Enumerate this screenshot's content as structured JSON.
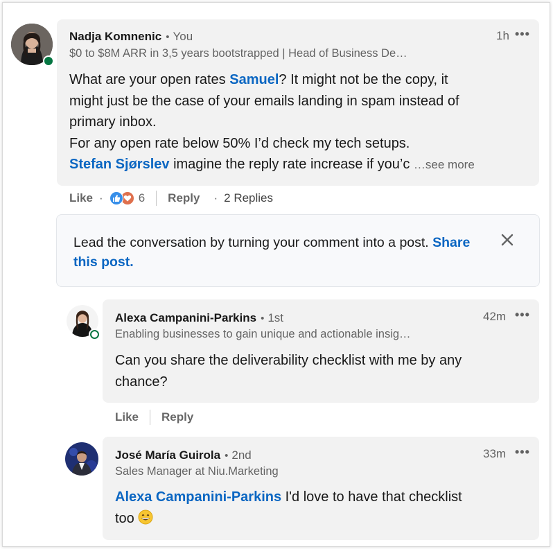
{
  "comment1": {
    "author": "Nadja Komnenic",
    "degree": "You",
    "bullet": "•",
    "headline": "$0 to $8M ARR in 3,5 years bootstrapped | Head of Business De…",
    "time": "1h",
    "more_label": "•••",
    "body": {
      "line1_a": "What are your open rates ",
      "mention1": "Samuel",
      "line1_b": "? It might not be the copy, it",
      "line2": "might just be the case of your emails landing in spam instead of",
      "line3": "primary inbox.",
      "line4": "For any open rate below 50% I’d check my tech setups.",
      "mention2": "Stefan Sjørslev",
      "line5_b": " imagine the reply rate increase if you’c",
      "see_more": "…see more"
    },
    "actions": {
      "like": "Like",
      "dot": "·",
      "reaction_count": "6",
      "reply": "Reply",
      "replies": "2 Replies"
    }
  },
  "nudge": {
    "text": "Lead the conversation by turning your comment into a post. ",
    "link": "Share this post."
  },
  "reply1": {
    "author": "Alexa Campanini-Parkins",
    "bullet": "•",
    "degree": "1st",
    "headline": "Enabling businesses to gain unique and actionable insig…",
    "time": "42m",
    "more_label": "•••",
    "body_line1": "Can you share the deliverability checklist with me by any",
    "body_line2": "chance?",
    "actions": {
      "like": "Like",
      "reply": "Reply"
    }
  },
  "reply2": {
    "author": "José María Guirola",
    "bullet": "•",
    "degree": "2nd",
    "headline": "Sales Manager at Niu.Marketing",
    "time": "33m",
    "more_label": "•••",
    "mention": "Alexa Campanini-Parkins",
    "body_line1_b": " I'd love to have that checklist",
    "body_line2": "too "
  },
  "colors": {
    "link": "#0a66c2",
    "presence": "#057642",
    "bubble": "#f2f2f2",
    "like_blue": "#378fe9",
    "love_red": "#df704d"
  },
  "icons": [
    "like-reaction-icon",
    "love-reaction-icon",
    "close-icon",
    "more-icon",
    "grin-emoji-icon"
  ]
}
